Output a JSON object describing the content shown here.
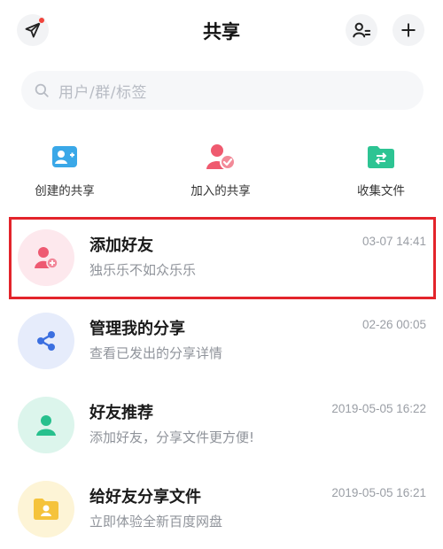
{
  "header": {
    "title": "共享",
    "left_icon": "paper-plane-icon",
    "right_icons": [
      "contacts-list-icon",
      "plus-icon"
    ]
  },
  "search": {
    "placeholder": "用户/群/标签"
  },
  "quick_actions": [
    {
      "label": "创建的共享",
      "icon": "add-user-card-icon",
      "color": "#3aa8e8"
    },
    {
      "label": "加入的共享",
      "icon": "joined-user-icon",
      "color": "#ef5a6f"
    },
    {
      "label": "收集文件",
      "icon": "folder-transfer-icon",
      "color": "#2dc493"
    }
  ],
  "list": [
    {
      "title": "添加好友",
      "subtitle": "独乐乐不如众乐乐",
      "time": "03-07 14:41",
      "icon": "add-friend-icon",
      "bg": "#fde8ed",
      "color": "#ee5a72"
    },
    {
      "title": "管理我的分享",
      "subtitle": "查看已发出的分享详情",
      "time": "02-26 00:05",
      "icon": "share-nodes-icon",
      "bg": "#e6ecfb",
      "color": "#3b6fe0"
    },
    {
      "title": "好友推荐",
      "subtitle": "添加好友，分享文件更方便!",
      "time": "2019-05-05 16:22",
      "icon": "user-icon",
      "bg": "#dcf5ec",
      "color": "#27c08d"
    },
    {
      "title": "给好友分享文件",
      "subtitle": "立即体验全新百度网盘",
      "time": "2019-05-05 16:21",
      "icon": "folder-user-icon",
      "bg": "#fdf4d6",
      "color": "#f5c33b"
    }
  ],
  "highlight_color": "#e3242b"
}
